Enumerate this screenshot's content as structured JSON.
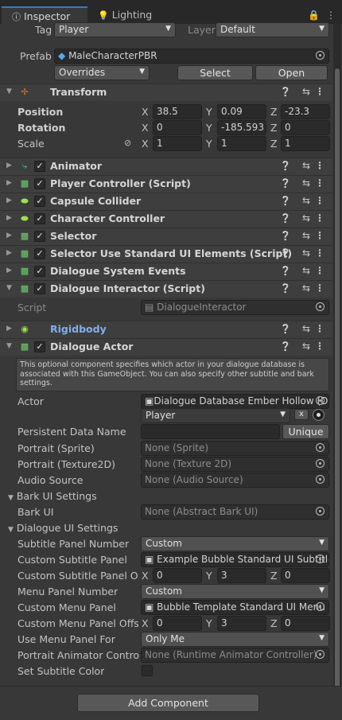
{
  "tabs": {
    "inspector": "Inspector",
    "lighting": "Lighting"
  },
  "header": {
    "tag_label": "Tag",
    "tag_value": "Player",
    "layer_label": "Layer",
    "layer_value": "Default",
    "prefab_label": "Prefab",
    "prefab_value": "MaleCharacterPBR",
    "overrides": "Overrides",
    "select": "Select",
    "open": "Open"
  },
  "transform": {
    "title": "Transform",
    "position_label": "Position",
    "position": {
      "x": "38.5",
      "y": "0.09",
      "z": "-23.3"
    },
    "rotation_label": "Rotation",
    "rotation": {
      "x": "0",
      "y": "-185.593",
      "z": "0"
    },
    "scale_label": "Scale",
    "scale": {
      "x": "1",
      "y": "1",
      "z": "1"
    },
    "axes": {
      "x": "X",
      "y": "Y",
      "z": "Z"
    }
  },
  "components": [
    "Animator",
    "Player Controller (Script)",
    "Capsule Collider",
    "Character Controller",
    "Selector",
    "Selector Use Standard UI Elements (Script)",
    "Dialogue System Events",
    "Dialogue Interactor (Script)"
  ],
  "interactor": {
    "script_label": "Script",
    "script_value": "DialogueInteractor"
  },
  "rigidbody": {
    "title": "Rigidbody"
  },
  "actor": {
    "title": "Dialogue Actor",
    "help": "This optional component specifies which actor in your dialogue database is associated with this GameObject. You can also specify other subtitle and bark settings.",
    "actor_label": "Actor",
    "actor_db": "Dialogue Database Ember Hollow (D",
    "actor_value": "Player",
    "x_btn": "x",
    "persistent_label": "Persistent Data Name",
    "unique": "Unique",
    "portrait_sprite_label": "Portrait (Sprite)",
    "portrait_sprite_value": "None (Sprite)",
    "portrait_tex_label": "Portrait (Texture2D)",
    "portrait_tex_value": "None (Texture 2D)",
    "audio_label": "Audio Source",
    "audio_value": "None (Audio Source)",
    "bark_section": "Bark UI Settings",
    "bark_label": "Bark UI",
    "bark_value": "None (Abstract Bark UI)",
    "dialogue_section": "Dialogue UI Settings",
    "subtitle_num_label": "Subtitle Panel Number",
    "subtitle_num_value": "Custom",
    "custom_subtitle_label": "Custom Subtitle Panel",
    "custom_subtitle_value": "Example Bubble Standard UI Subtitle",
    "subtitle_offset_label": "Custom Subtitle Panel Offset",
    "subtitle_offset": {
      "x": "0",
      "y": "3",
      "z": "0"
    },
    "menu_num_label": "Menu Panel Number",
    "menu_num_value": "Custom",
    "custom_menu_label": "Custom Menu Panel",
    "custom_menu_value": "Bubble Template Standard UI Menu",
    "menu_offset_label": "Custom Menu Panel Offset",
    "menu_offset": {
      "x": "0",
      "y": "3",
      "z": "0"
    },
    "use_menu_label": "Use Menu Panel For",
    "use_menu_value": "Only Me",
    "portrait_anim_label": "Portrait Animator Controller",
    "portrait_anim_value": "None (Runtime Animator Controller)",
    "subtitle_color_label": "Set Subtitle Color"
  },
  "add_component": "Add Component",
  "colors": {
    "accent": "#3a79bb",
    "rigidbody_title": "#7eb0f0",
    "background": "#383838"
  }
}
